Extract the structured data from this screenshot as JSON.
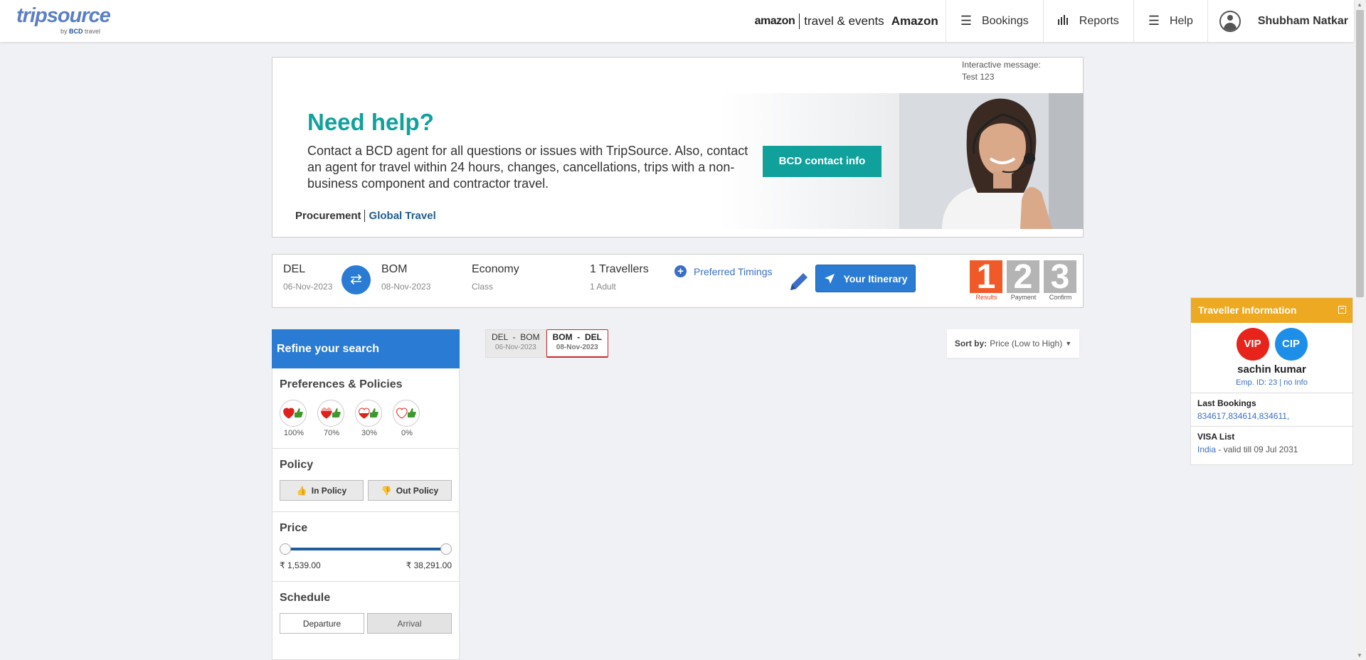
{
  "header": {
    "logo_text": "tripsource",
    "logo_by": "by",
    "logo_bcd": "BCD",
    "logo_travel": "travel",
    "amazon_brand": "amazon",
    "amazon_sub": "travel & events",
    "company": "Amazon",
    "nav": [
      {
        "label": "Bookings",
        "icon": "menu-icon"
      },
      {
        "label": "Reports",
        "icon": "bar-chart-icon"
      },
      {
        "label": "Help",
        "icon": "menu-icon"
      }
    ],
    "user_name": "Shubham Natkar"
  },
  "message": {
    "interactive_label": "Interactive message:",
    "interactive_text": "Test 123",
    "banner_title": "Need help?",
    "banner_text": "Contact a BCD agent for all questions or issues with TripSource. Also, contact an agent for travel within 24 hours, changes, cancellations, trips with a non-business component and contractor travel.",
    "banner_button": "BCD contact info",
    "footer_procurement": "Procurement",
    "footer_global": "Global Travel"
  },
  "search": {
    "from_code": "DEL",
    "from_date": "06-Nov-2023",
    "to_code": "BOM",
    "to_date": "08-Nov-2023",
    "class_value": "Economy",
    "class_label": "Class",
    "travellers_value": "1 Travellers",
    "travellers_sub": "1 Adult",
    "preferred_timings": "Preferred Timings",
    "itinerary_button": "Your Itinerary",
    "steps": [
      {
        "num": "1",
        "label": "Results",
        "color": "#f05a28",
        "active": true
      },
      {
        "num": "2",
        "label": "Payment",
        "color": "#b4b4b4",
        "active": false
      },
      {
        "num": "3",
        "label": "Confirm",
        "color": "#b4b4b4",
        "active": false
      }
    ]
  },
  "filters": {
    "title": "Refine your search",
    "preferences_title": "Preferences & Policies",
    "preferences": [
      "100%",
      "70%",
      "30%",
      "0%"
    ],
    "policy_title": "Policy",
    "in_policy": "In Policy",
    "out_policy": "Out Policy",
    "price_title": "Price",
    "price_min": "₹ 1,539.00",
    "price_max": "₹ 38,291.00",
    "schedule_title": "Schedule",
    "departure": "Departure",
    "arrival": "Arrival"
  },
  "legs": [
    {
      "from": "DEL",
      "to": "BOM",
      "date": "06-Nov-2023",
      "active": false
    },
    {
      "from": "BOM",
      "to": "DEL",
      "date": "08-Nov-2023",
      "active": true
    }
  ],
  "sort": {
    "label": "Sort by:",
    "value": "Price (Low to High)"
  },
  "traveller": {
    "title": "Traveller Information",
    "badges": [
      {
        "text": "VIP",
        "color": "#e8231b"
      },
      {
        "text": "CIP",
        "color": "#1e8fe8"
      }
    ],
    "name": "sachin kumar",
    "emp": "Emp. ID: 23 | no Info",
    "last_bookings_title": "Last Bookings",
    "last_bookings": "834617,834614,834611,",
    "visa_title": "VISA List",
    "visa_country": "India",
    "visa_valid": " - valid till 09 Jul 2031"
  }
}
